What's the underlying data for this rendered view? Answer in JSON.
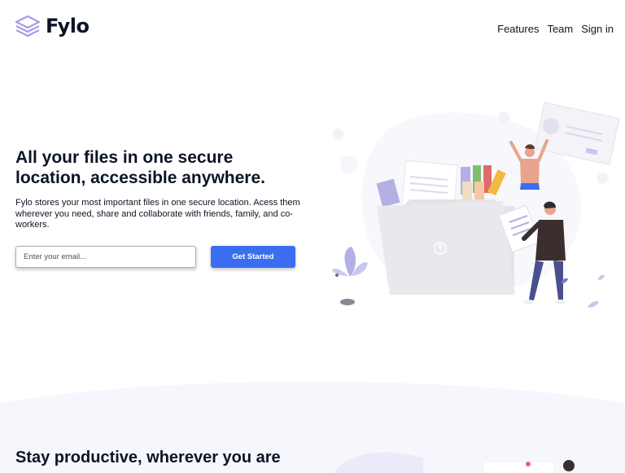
{
  "header": {
    "brand": "Fylo",
    "logo_icon": "stacked-layers-icon",
    "nav": [
      {
        "label": "Features"
      },
      {
        "label": "Team"
      },
      {
        "label": "Sign in"
      }
    ]
  },
  "hero": {
    "title": "All your files in one secure location, accessible anywhere.",
    "description": "Fylo stores your most important files in one secure location. Acess them wherever you need, share and collaborate with friends, family, and co-workers.",
    "email_placeholder": "Enter your email...",
    "cta_label": "Get Started",
    "illustration": "file-folder-collaboration-illustration"
  },
  "section2": {
    "title": "Stay productive, wherever you are"
  },
  "colors": {
    "primary": "#3a6df0",
    "text": "#0c1524",
    "section_bg": "#f6f6fd",
    "logo_violet": "#a99ce7"
  }
}
